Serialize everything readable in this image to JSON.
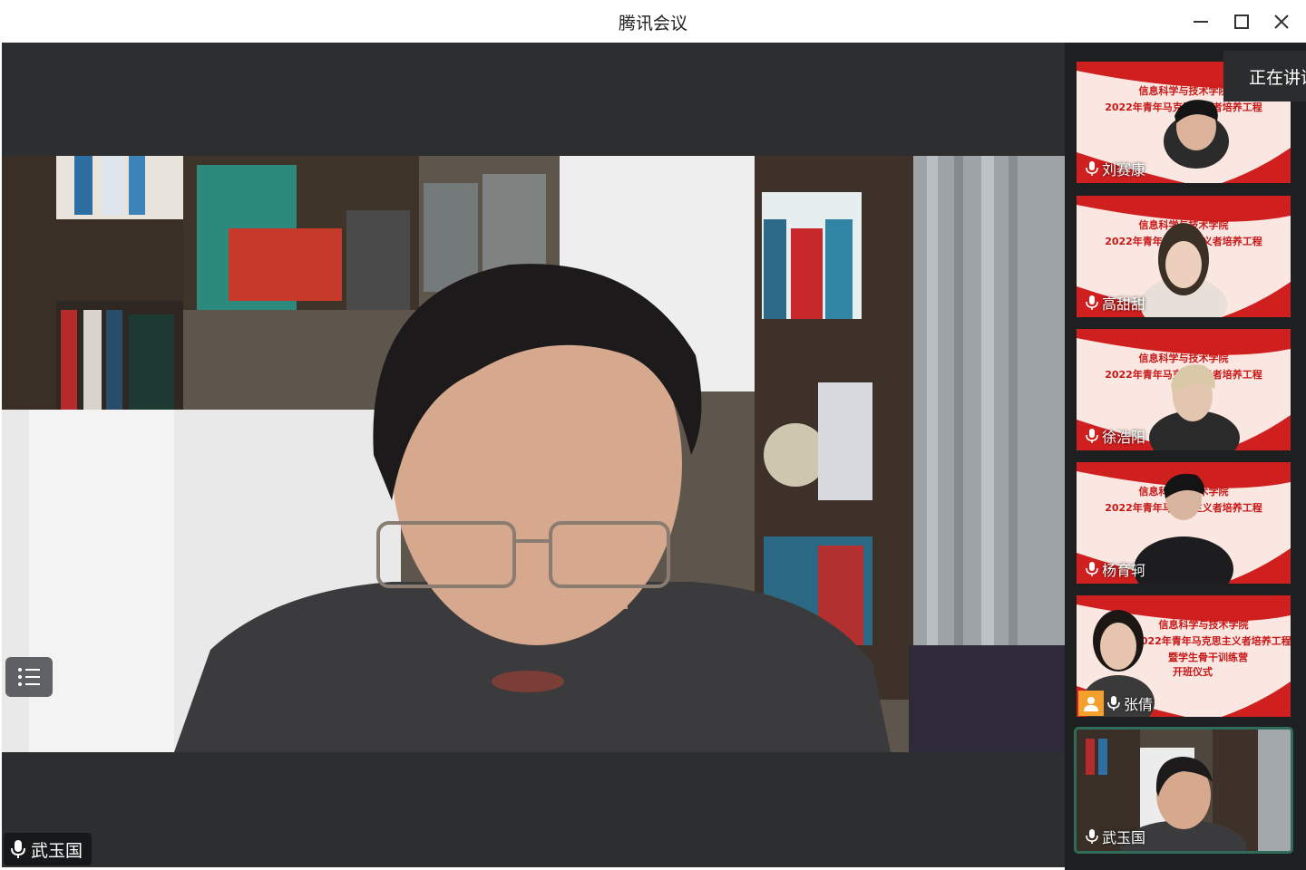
{
  "window": {
    "title": "腾讯会议"
  },
  "main": {
    "speaker_name": "武玉国"
  },
  "recording": {
    "label": "正在讲话"
  },
  "banner": {
    "line1": "信息科学与技术学院",
    "line2": "2022年青年马克思主义者培养工程",
    "line3": "暨学生骨干训练营",
    "line4": "开班仪式"
  },
  "participants": [
    {
      "name": "刘赛康"
    },
    {
      "name": "高甜甜"
    },
    {
      "name": "徐浩阳"
    },
    {
      "name": "杨育轲"
    },
    {
      "name": "张倩"
    },
    {
      "name": "武玉国"
    }
  ],
  "colors": {
    "title_bar": "#ffffff",
    "stage_bg": "#2d2e30",
    "sidebar_bg": "#1e1f21",
    "banner_red": "#d01f1f",
    "active_border": "#2f6d5a",
    "host_badge": "#f5a02a"
  }
}
